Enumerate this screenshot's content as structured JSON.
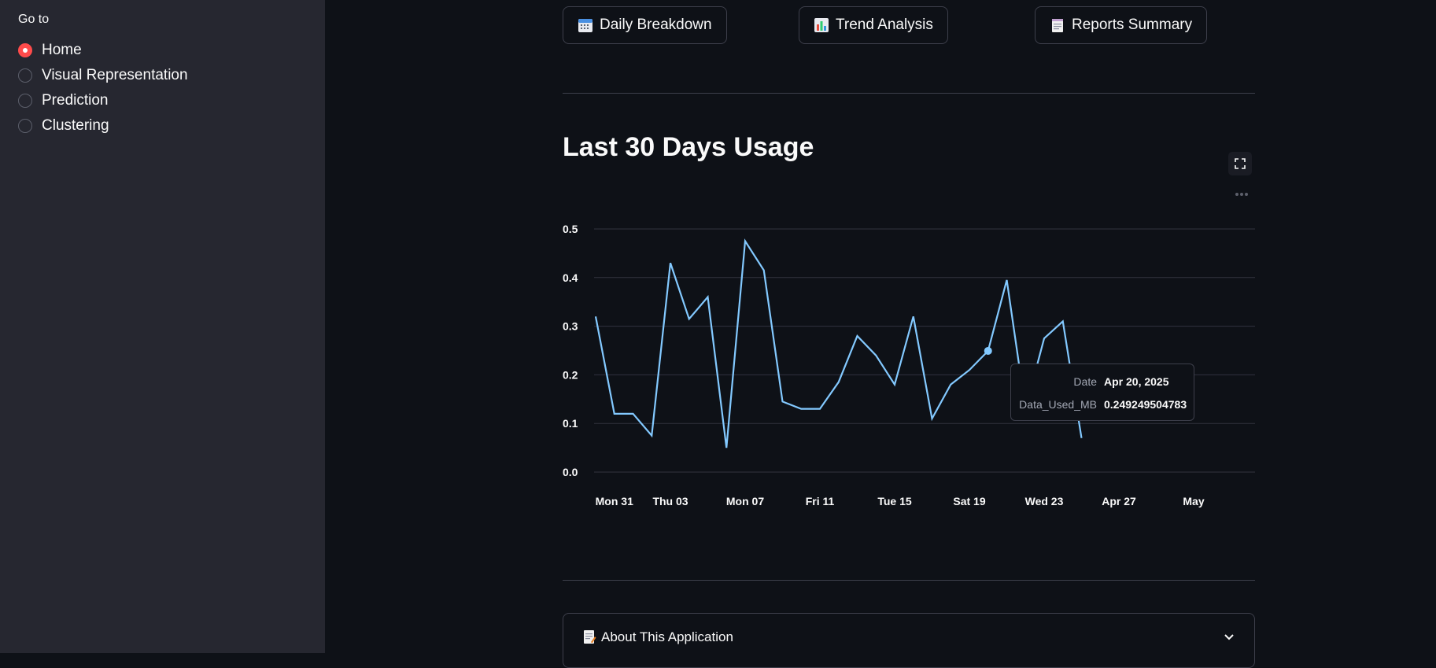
{
  "sidebar": {
    "title": "Go to",
    "items": [
      {
        "label": "Home",
        "selected": true
      },
      {
        "label": "Visual Representation",
        "selected": false
      },
      {
        "label": "Prediction",
        "selected": false
      },
      {
        "label": "Clustering",
        "selected": false
      }
    ]
  },
  "buttons": [
    {
      "label": "Daily Breakdown",
      "icon": "calendar-icon"
    },
    {
      "label": "Trend Analysis",
      "icon": "bar-chart-icon"
    },
    {
      "label": "Reports Summary",
      "icon": "notepad-icon"
    }
  ],
  "section": {
    "title": "Last 30 Days Usage"
  },
  "chart_data": {
    "type": "line",
    "title": "",
    "xlabel": "",
    "ylabel": "",
    "ylim": [
      0,
      0.5
    ],
    "yticks": [
      "0.0",
      "0.1",
      "0.2",
      "0.3",
      "0.4",
      "0.5"
    ],
    "xticks": [
      "Mon 31",
      "Thu 03",
      "Mon 07",
      "Fri 11",
      "Tue 15",
      "Sat 19",
      "Wed 23",
      "Apr 27",
      "May"
    ],
    "x": [
      "2025-03-30",
      "2025-03-31",
      "2025-04-01",
      "2025-04-02",
      "2025-04-03",
      "2025-04-04",
      "2025-04-05",
      "2025-04-06",
      "2025-04-07",
      "2025-04-08",
      "2025-04-09",
      "2025-04-10",
      "2025-04-11",
      "2025-04-12",
      "2025-04-13",
      "2025-04-14",
      "2025-04-15",
      "2025-04-16",
      "2025-04-17",
      "2025-04-18",
      "2025-04-19",
      "2025-04-20",
      "2025-04-21",
      "2025-04-22",
      "2025-04-23",
      "2025-04-24",
      "2025-04-25",
      "2025-04-26"
    ],
    "values": [
      0.32,
      0.12,
      0.12,
      0.075,
      0.43,
      0.315,
      0.36,
      0.05,
      0.475,
      0.415,
      0.145,
      0.13,
      0.13,
      0.185,
      0.28,
      0.24,
      0.18,
      0.32,
      0.11,
      0.18,
      0.21,
      0.249249504783,
      0.395,
      0.13,
      0.275,
      0.31,
      0.07
    ],
    "series_color": "#83c9ff",
    "grid": true,
    "highlight": {
      "date": "Apr 20, 2025",
      "value": "0.249249504783"
    }
  },
  "tooltip": {
    "date_key": "Date",
    "date_val": "Apr 20, 2025",
    "value_key": "Data_Used_MB",
    "value_val": "0.249249504783"
  },
  "expander": {
    "label": "About This Application",
    "icon": "memo-icon"
  },
  "colors": {
    "accent": "#ff4b4b",
    "background": "#0e1117",
    "sidebar": "#262730",
    "line": "#83c9ff"
  }
}
